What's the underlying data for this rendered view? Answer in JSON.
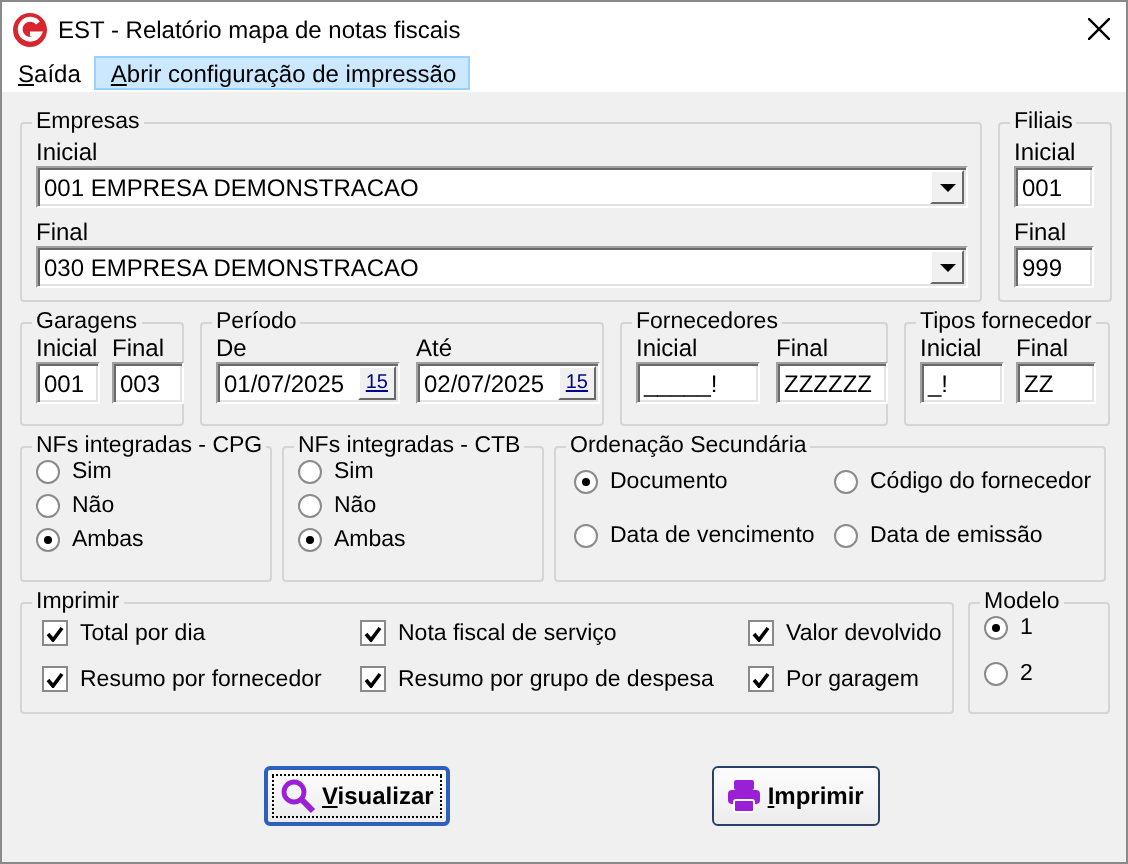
{
  "window": {
    "title": "EST - Relatório mapa de notas fiscais"
  },
  "menu": [
    {
      "label": "Saída",
      "selected": false
    },
    {
      "label": "Abrir configuração de impressão",
      "selected": true
    }
  ],
  "empresas": {
    "title": "Empresas",
    "fields": [
      {
        "label": "Inicial",
        "value": "001 EMPRESA DEMONSTRACAO"
      },
      {
        "label": "Final",
        "value": "030 EMPRESA DEMONSTRACAO"
      }
    ]
  },
  "filiais": {
    "title": "Filiais",
    "fields": [
      {
        "label": "Inicial",
        "value": "001"
      },
      {
        "label": "Final",
        "value": "999"
      }
    ]
  },
  "ranges": [
    {
      "title": "Garagens",
      "fields": [
        {
          "label": "Inicial",
          "value": "001"
        },
        {
          "label": "Final",
          "value": "003"
        }
      ]
    },
    {
      "title": "Período",
      "fields": [
        {
          "label": "De",
          "value": "01/07/2025",
          "calendar": "15"
        },
        {
          "label": "Até",
          "value": "02/07/2025",
          "calendar": "15"
        }
      ]
    },
    {
      "title": "Fornecedores",
      "fields": [
        {
          "label": "Inicial",
          "value": "_____!"
        },
        {
          "label": "Final",
          "value": "ZZZZZZ"
        }
      ]
    },
    {
      "title": "Tipos fornecedor",
      "fields": [
        {
          "label": "Inicial",
          "value": "_!"
        },
        {
          "label": "Final",
          "value": "ZZ"
        }
      ]
    }
  ],
  "radio_groups": [
    {
      "title": "NFs integradas - CPG",
      "kind": "stack",
      "options": [
        {
          "label": "Sim",
          "selected": false
        },
        {
          "label": "Não",
          "selected": false
        },
        {
          "label": "Ambas",
          "selected": true
        }
      ]
    },
    {
      "title": "NFs integradas - CTB",
      "kind": "stack",
      "options": [
        {
          "label": "Sim",
          "selected": false
        },
        {
          "label": "Não",
          "selected": false
        },
        {
          "label": "Ambas",
          "selected": true
        }
      ]
    },
    {
      "title": "Ordenação Secundária",
      "kind": "grid",
      "options": [
        {
          "label": "Documento",
          "selected": true
        },
        {
          "label": "Código do fornecedor",
          "selected": false
        },
        {
          "label": "Data de vencimento",
          "selected": false
        },
        {
          "label": "Data de emissão",
          "selected": false
        }
      ]
    }
  ],
  "imprimir": {
    "title": "Imprimir",
    "options": [
      {
        "label": "Total por dia",
        "checked": true
      },
      {
        "label": "Nota fiscal de serviço",
        "checked": true
      },
      {
        "label": "Valor devolvido",
        "checked": true
      },
      {
        "label": "Resumo por fornecedor",
        "checked": true
      },
      {
        "label": "Resumo por grupo de despesa",
        "checked": true
      },
      {
        "label": "Por garagem",
        "checked": true
      }
    ]
  },
  "modelo": {
    "title": "Modelo",
    "options": [
      {
        "label": "1",
        "selected": true
      },
      {
        "label": "2",
        "selected": false
      }
    ]
  },
  "buttons": [
    {
      "label": "Visualizar",
      "kind": "search",
      "focused": true
    },
    {
      "label": "Imprimir",
      "kind": "print",
      "focused": false
    }
  ]
}
